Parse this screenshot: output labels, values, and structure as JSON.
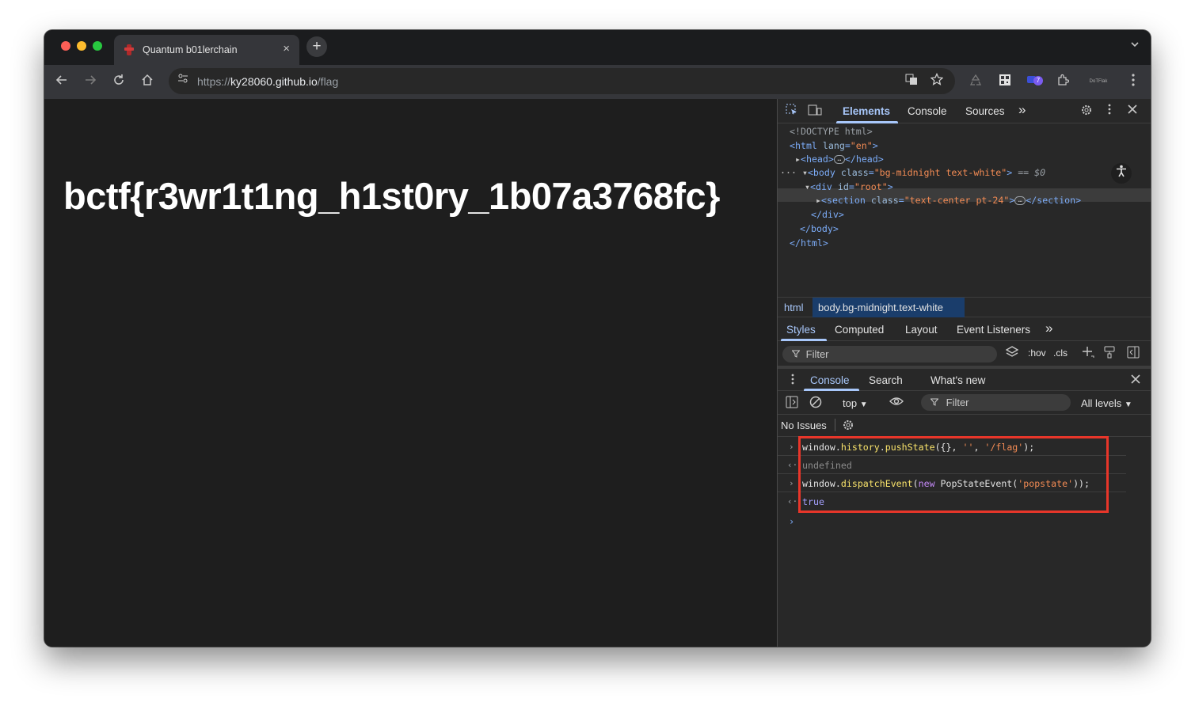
{
  "browser": {
    "tab_title": "Quantum b01lerchain",
    "tab_close": "×",
    "new_tab": "+",
    "tab_menu": "⌄",
    "url_scheme": "https://",
    "url_host": "ky28060.github.io",
    "url_path": "/flag",
    "profile_label": "DoTFlak",
    "extension_badge": "7"
  },
  "page": {
    "flag_text": "bctf{r3wr1t1ng_h1st0ry_1b07a3768fc}",
    "background": "#1e1e1e"
  },
  "devtools": {
    "tabs": [
      "Elements",
      "Console",
      "Sources"
    ],
    "more_tabs": "»",
    "dom": {
      "doctype": "<!DOCTYPE html>",
      "html_open_tag": "<html",
      "html_lang_attr": "lang",
      "html_lang_val": "\"en\"",
      "close_bracket": ">",
      "head_open": "<head>",
      "head_close": "</head>",
      "ellipsis": "…",
      "body_open": "<body",
      "body_class_attr": "class",
      "body_class_val": "\"bg-midnight text-white\"",
      "selected_marker": "== $0",
      "div_open": "<div",
      "div_id_attr": "id",
      "div_id_val": "\"root\"",
      "section_open": "<section",
      "section_class_attr": "class",
      "section_class_val": "\"text-center pt-24\"",
      "section_close": "</section>",
      "div_close": "</div>",
      "body_close": "</body>",
      "html_close": "</html>",
      "row_dots": "···"
    },
    "breadcrumbs": [
      "html",
      "body.bg-midnight.text-white"
    ],
    "styles_tabs": [
      "Styles",
      "Computed",
      "Layout",
      "Event Listeners"
    ],
    "styles_more": "»",
    "styles_filter_placeholder": "Filter",
    "hov_label": ":hov",
    "cls_label": ".cls",
    "drawer_tabs": [
      "Console",
      "Search",
      "What's new"
    ],
    "console_context": "top",
    "console_filter_placeholder": "Filter",
    "log_levels": "All levels",
    "issues": "No Issues",
    "console_lines": [
      {
        "type": "input",
        "parts": [
          [
            "plain",
            "window."
          ],
          [
            "prop",
            "history"
          ],
          [
            "plain",
            "."
          ],
          [
            "prop",
            "pushState"
          ],
          [
            "plain",
            "({}, "
          ],
          [
            "str",
            "''"
          ],
          [
            "plain",
            ", "
          ],
          [
            "str",
            "'/flag'"
          ],
          [
            "plain",
            ");"
          ]
        ]
      },
      {
        "type": "output",
        "parts": [
          [
            "undef",
            "undefined"
          ]
        ]
      },
      {
        "type": "input",
        "parts": [
          [
            "plain",
            "window."
          ],
          [
            "prop",
            "dispatchEvent"
          ],
          [
            "plain",
            "("
          ],
          [
            "kw",
            "new"
          ],
          [
            "plain",
            " PopStateEvent("
          ],
          [
            "str",
            "'popstate'"
          ],
          [
            "plain",
            "));"
          ]
        ]
      },
      {
        "type": "output",
        "parts": [
          [
            "truev",
            "true"
          ]
        ]
      }
    ],
    "input_arrow": "›",
    "output_arrow": "‹·",
    "prompt": "›"
  },
  "colors": {
    "accent": "#a8c7fa",
    "highlight_box": "#e8362a"
  }
}
